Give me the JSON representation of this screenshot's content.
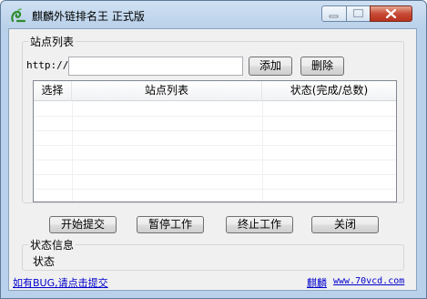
{
  "window": {
    "title": "麒麟外链排名王 正式版",
    "icon": "logo-icon",
    "controls": {
      "minimize": "minimize-icon",
      "maximize": "maximize-icon",
      "close": "close-icon"
    }
  },
  "site_group": {
    "label": "站点列表",
    "url_prefix": "http://",
    "url_value": "",
    "add_label": "添加",
    "delete_label": "删除"
  },
  "table": {
    "columns": [
      "选择",
      "站点列表",
      "状态(完成/总数)"
    ],
    "rows": []
  },
  "actions": {
    "start": "开始提交",
    "pause": "暂停工作",
    "stop": "终止工作",
    "close": "关闭"
  },
  "status_group": {
    "label": "状态信息",
    "status_text": "状态"
  },
  "footer": {
    "bug_link": "如有BUG,请点击提交",
    "brand": "麒麟",
    "site_link": "www.70vcd.com"
  },
  "colors": {
    "link": "#0000cc",
    "titlebar": "#b9d1ea",
    "close_button": "#c74b36"
  }
}
